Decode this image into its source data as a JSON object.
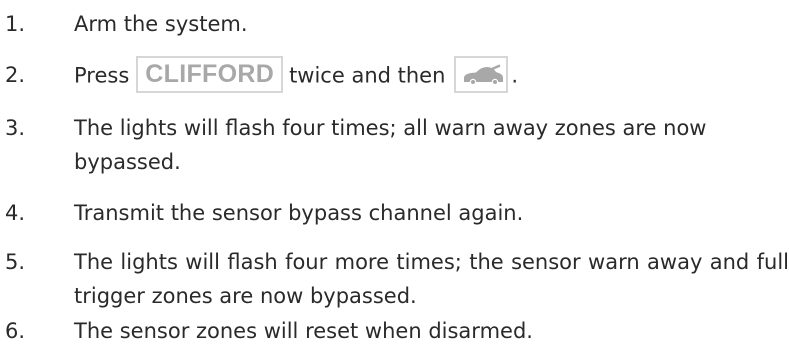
{
  "steps": [
    {
      "number": "1.",
      "text": "Arm the system."
    },
    {
      "number": "2.",
      "before": "Press",
      "button_label": "CLIFFORD",
      "middle": "twice and then",
      "after": ".",
      "car_icon": "car-lock-icon"
    },
    {
      "number": "3.",
      "text": "The lights will flash four times; all warn away zones are now bypassed."
    },
    {
      "number": "4.",
      "text": "Transmit the sensor bypass channel again."
    },
    {
      "number": "5.",
      "text": "The lights will flash four more times; the sensor warn away and full trigger zones are now bypassed."
    },
    {
      "number": "6.",
      "text": "The sensor zones will reset when disarmed."
    }
  ],
  "colors": {
    "text": "#2a2a2a",
    "button_border": "#d6d6d6",
    "button_label": "#a8a8a8"
  }
}
